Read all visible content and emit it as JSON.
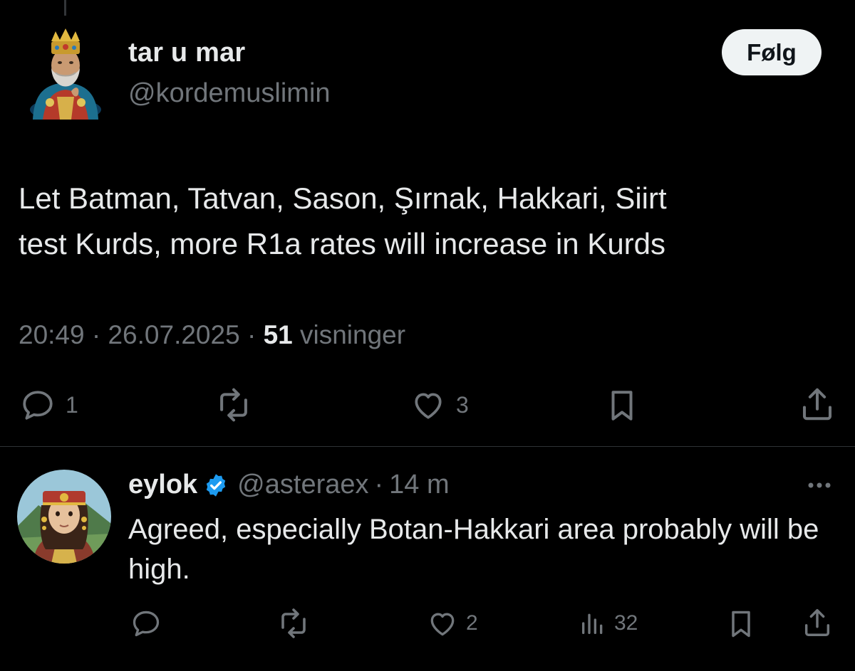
{
  "tweet": {
    "author": {
      "display_name": "tar u mar",
      "handle": "@kordemuslimin",
      "avatar_icon": "bearded-king-avatar"
    },
    "follow_label": "Følg",
    "text": "Let Batman, Tatvan, Sason, Şırnak, Hakkari, Siirt\ntest Kurds, more R1a rates will increase in Kurds",
    "time": "20:49",
    "date": "26.07.2025",
    "separator": "·",
    "views_count": "51",
    "views_label": "visninger",
    "actions": {
      "replies": "1",
      "reposts": "",
      "likes": "3"
    }
  },
  "reply": {
    "display_name": "eylok",
    "verified": true,
    "handle": "@asteraex",
    "separator": "·",
    "time": "14 m",
    "avatar_icon": "woman-headdress-avatar",
    "text": "Agreed, especially Botan-Hakkari area probably will be high.",
    "actions": {
      "replies": "",
      "reposts": "",
      "likes": "2",
      "views": "32"
    }
  },
  "colors": {
    "background": "#000000",
    "text_primary": "#e7e9ea",
    "text_secondary": "#71767b",
    "verified_blue": "#1d9bf0",
    "follow_bg": "#eff3f4"
  }
}
